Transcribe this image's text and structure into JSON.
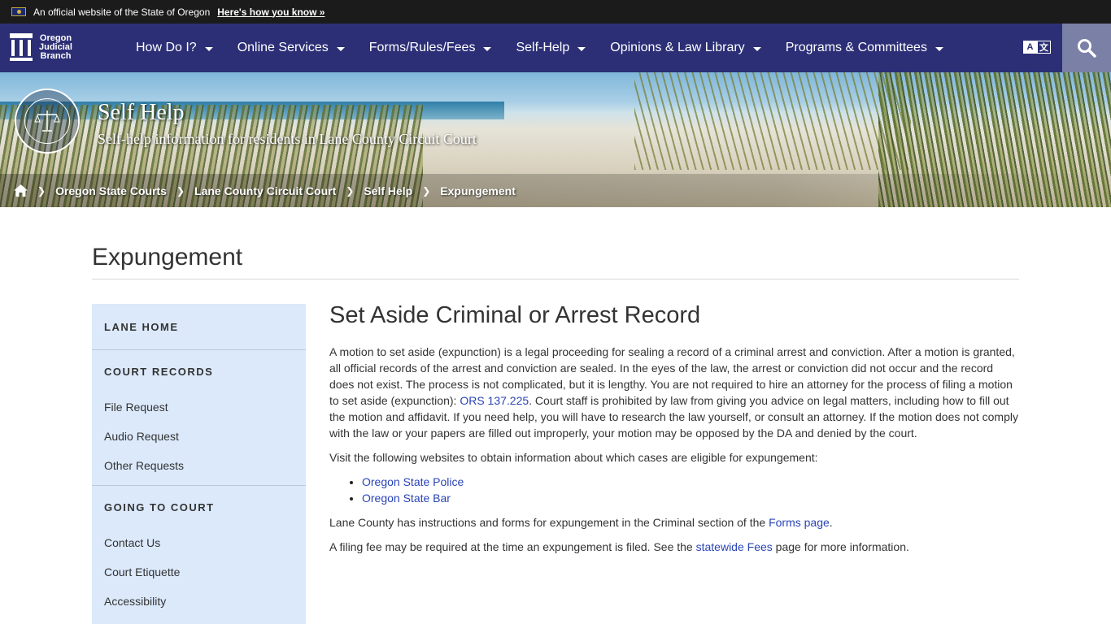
{
  "gov_banner": {
    "text": "An official website of the State of Oregon",
    "link": "Here's how you know »"
  },
  "logo": {
    "line1": "Oregon",
    "line2": "Judicial",
    "line3": "Branch"
  },
  "nav": {
    "items": [
      {
        "label": "How Do I?"
      },
      {
        "label": "Online Services"
      },
      {
        "label": "Forms/Rules/Fees"
      },
      {
        "label": "Self-Help"
      },
      {
        "label": "Opinions & Law Library"
      },
      {
        "label": "Programs & Committees"
      }
    ],
    "translate_a": "A",
    "translate_b": "文"
  },
  "hero": {
    "title": "Self Help",
    "subtitle": "Self-help information for residents in Lane County Circuit Court",
    "seal_alt": "Judicial Department State of Oregon seal"
  },
  "breadcrumb": [
    "Oregon State Courts",
    "Lane County Circuit Court",
    "Self Help",
    "Expungement"
  ],
  "page": {
    "title": "Expungement"
  },
  "sidebar": {
    "sections": [
      {
        "heading": "LANE HOME",
        "links": []
      },
      {
        "heading": "COURT RECORDS",
        "links": [
          "File Request",
          "Audio Request",
          "Other Requests"
        ]
      },
      {
        "heading": "GOING TO COURT",
        "links": [
          "Contact Us",
          "Court Etiquette",
          "Accessibility"
        ]
      }
    ]
  },
  "content": {
    "heading": "Set Aside Criminal or Arrest Record",
    "p1_a": "A motion to set aside (expunction) is a legal proceeding for sealing a record of a criminal arrest and conviction. After a motion is granted, all official records of the arrest and conviction are sealed. In the eyes of the law, the arrest or conviction did not occur and the record does not exist. The process is not complicated, but it is lengthy. You are not required to hire an attorney for the process of filing a motion to set aside (expunction): ",
    "p1_link": "ORS 137.225",
    "p1_b": ". Court staff is prohibited by law from giving you advice on legal matters, including how to fill out the motion and affidavit. If you need help, you will have to research the law yourself, or consult an attorney. If the motion does not comply with the law or your papers are filled out improperly, your motion may be opposed by the DA and denied by the court.",
    "p2": "Visit the following websites to obtain information about which cases are eligible for expungement:",
    "list": [
      "Oregon State Police",
      "Oregon State Bar"
    ],
    "p3_a": "Lane County has instructions and forms for expungement in the Criminal section of the ",
    "p3_link": "Forms page",
    "p3_b": ".",
    "p4_a": "A filing fee may be required at the time an expungement is filed. See the ",
    "p4_link": "statewide Fees",
    "p4_b": " page for more information."
  }
}
